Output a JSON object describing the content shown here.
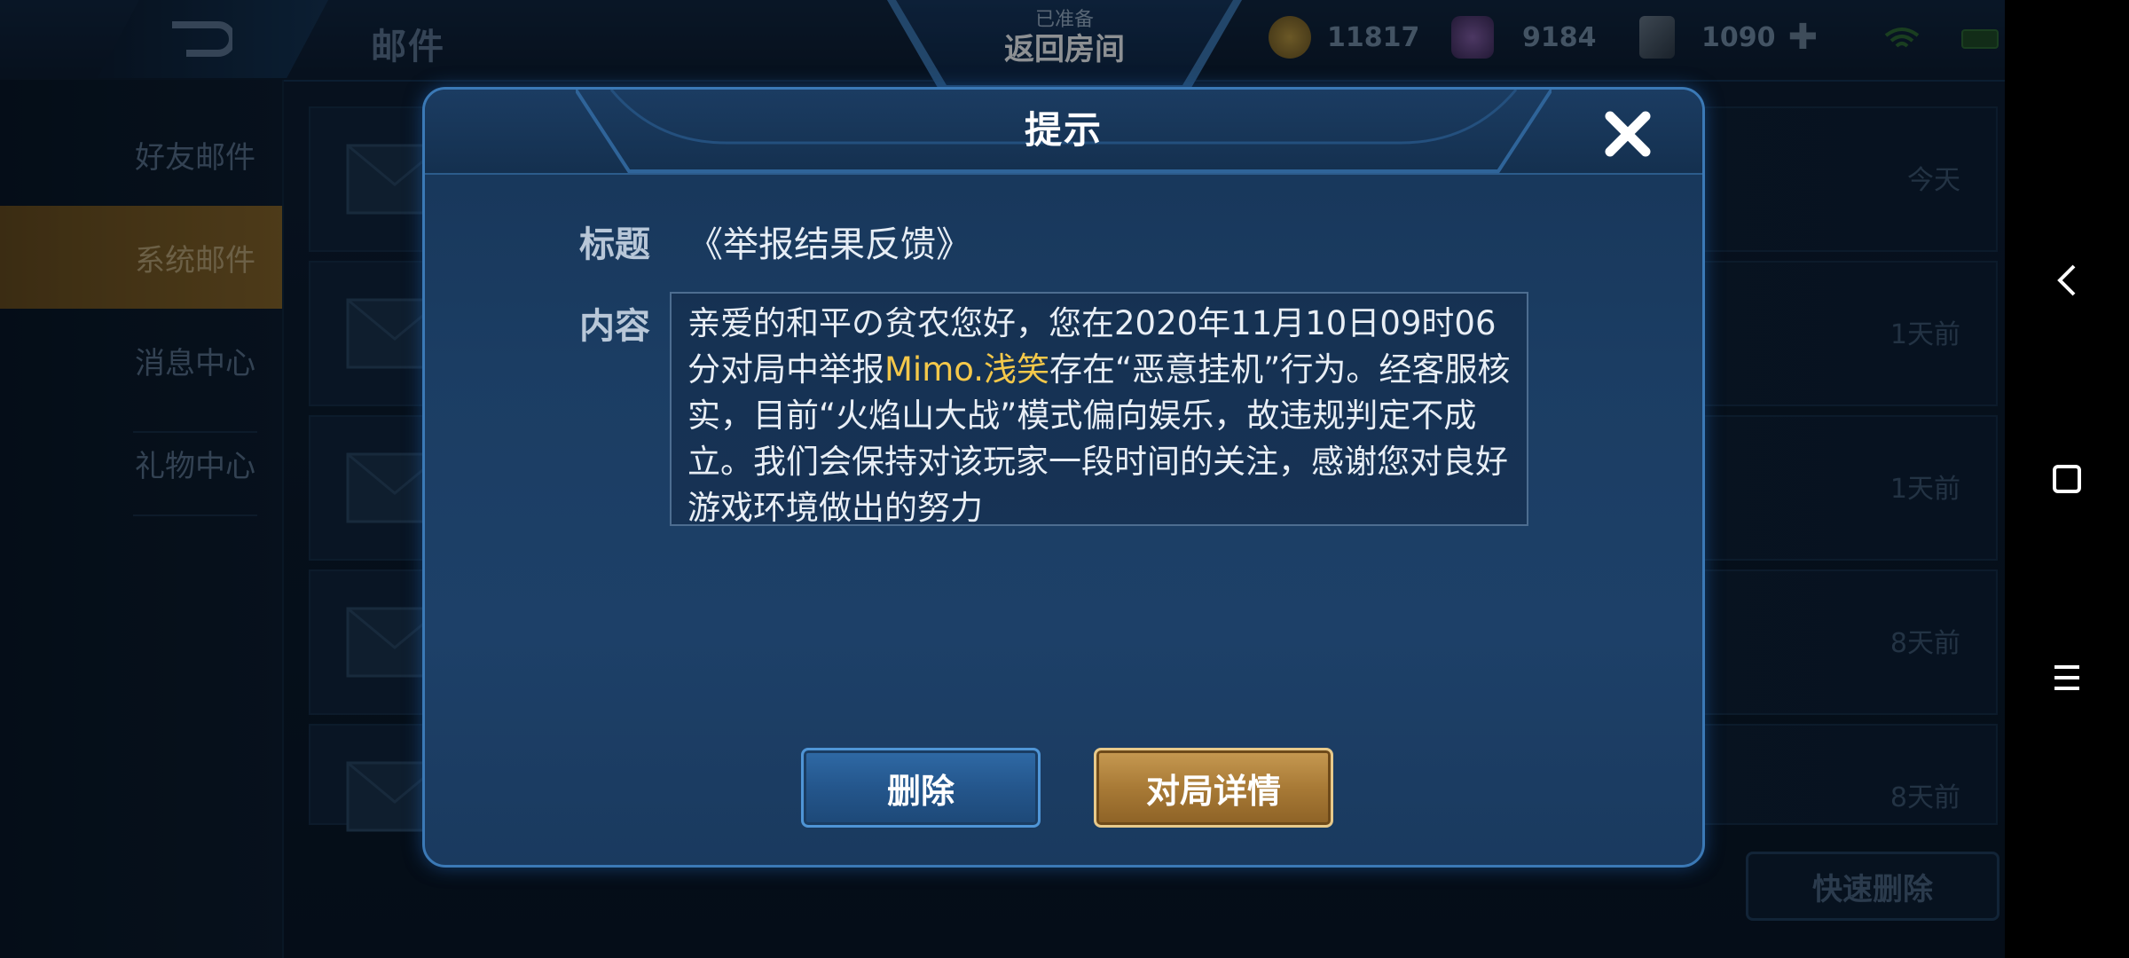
{
  "topbar": {
    "title": "邮件",
    "room_status": "已准备",
    "room_button": "返回房间",
    "gold": "11817",
    "gems": "9184",
    "coupons": "1090",
    "plus_icon": "plus-icon"
  },
  "sidebar": {
    "items": [
      {
        "label": "好友邮件",
        "active": false
      },
      {
        "label": "系统邮件",
        "active": true
      },
      {
        "label": "消息中心",
        "active": false
      },
      {
        "label": "礼物中心",
        "active": false
      }
    ]
  },
  "mail_list": {
    "rows": [
      {
        "time": "今天"
      },
      {
        "time": "1天前"
      },
      {
        "time": "1天前"
      },
      {
        "time": "8天前"
      },
      {
        "time": "8天前"
      }
    ],
    "quick_delete": "快速删除"
  },
  "dialog": {
    "title": "提示",
    "subject_label": "标题",
    "subject": "《举报结果反馈》",
    "content_label": "内容",
    "content_part1": "亲爱的和平の贫农您好，您在2020年11月10日09时06分对局中举报",
    "content_highlight": "Mimo.浅笑",
    "content_part2": "存在“恶意挂机”行为。经客服核实，目前“火焰山大战”模式偏向娱乐，故违规判定不成立。我们会保持对该玩家一段时间的关注，感谢您对良好游戏环境做出的努力",
    "delete_button": "删除",
    "detail_button": "对局详情"
  },
  "colors": {
    "highlight": "#f4c84a",
    "dialog_border": "#3b79b6",
    "gold_button": "#a87a36",
    "blue_button": "#24568c"
  }
}
